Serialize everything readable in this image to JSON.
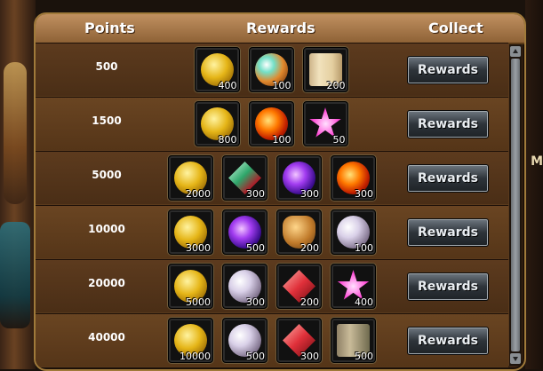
{
  "header": {
    "points": "Points",
    "rewards": "Rewards",
    "collect": "Collect"
  },
  "side_letter": "M",
  "rows": [
    {
      "points": "500",
      "button": "Rewards",
      "items": [
        {
          "icon": "gold-coin",
          "qty": "400"
        },
        {
          "icon": "ice-fire-orb",
          "qty": "100"
        },
        {
          "icon": "scroll",
          "qty": "200"
        }
      ]
    },
    {
      "points": "1500",
      "button": "Rewards",
      "items": [
        {
          "icon": "gold-coin",
          "qty": "800"
        },
        {
          "icon": "fire-orb",
          "qty": "100"
        },
        {
          "icon": "pink-star",
          "qty": "50"
        }
      ]
    },
    {
      "points": "5000",
      "button": "Rewards",
      "items": [
        {
          "icon": "gold-coin",
          "qty": "2000"
        },
        {
          "icon": "green-gem",
          "qty": "300"
        },
        {
          "icon": "purple-orb",
          "qty": "300"
        },
        {
          "icon": "fire-orb",
          "qty": "300"
        }
      ]
    },
    {
      "points": "10000",
      "button": "Rewards",
      "items": [
        {
          "icon": "gold-coin",
          "qty": "3000"
        },
        {
          "icon": "purple-orb",
          "qty": "500"
        },
        {
          "icon": "bronze-shield",
          "qty": "200"
        },
        {
          "icon": "pearl-orb",
          "qty": "100"
        }
      ]
    },
    {
      "points": "20000",
      "button": "Rewards",
      "items": [
        {
          "icon": "gold-coin",
          "qty": "5000"
        },
        {
          "icon": "pearl-orb",
          "qty": "300"
        },
        {
          "icon": "red-gem",
          "qty": "200"
        },
        {
          "icon": "pink-star",
          "qty": "400"
        }
      ]
    },
    {
      "points": "40000",
      "button": "Rewards",
      "items": [
        {
          "icon": "gold-coin",
          "qty": "10000"
        },
        {
          "icon": "pearl-orb",
          "qty": "500"
        },
        {
          "icon": "red-gem",
          "qty": "300"
        },
        {
          "icon": "map-scroll",
          "qty": "500"
        }
      ]
    }
  ]
}
